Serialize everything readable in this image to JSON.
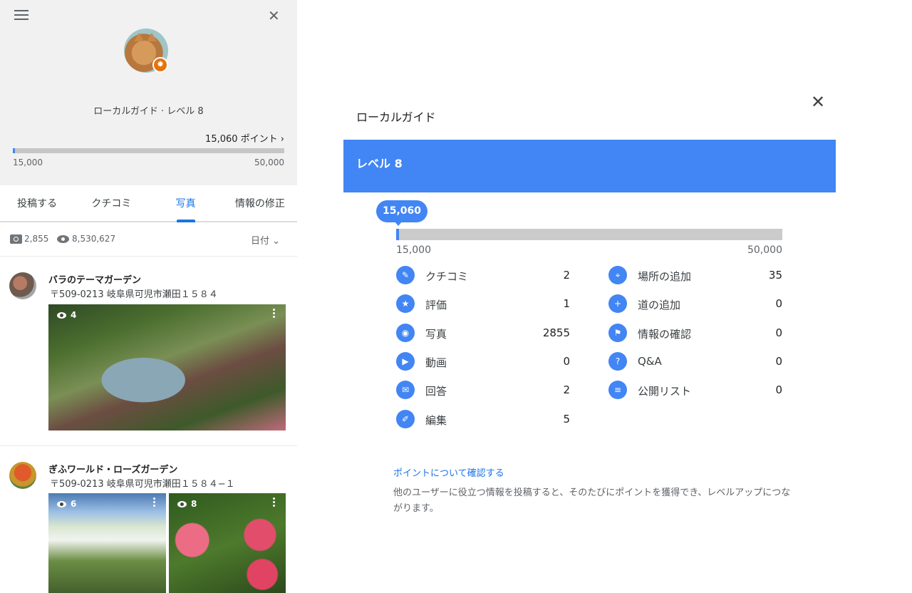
{
  "profile": {
    "guide_level": "ローカルガイド · レベル 8",
    "points_link": "15,060 ポイント ›",
    "bar_min": "15,000",
    "bar_max": "50,000",
    "progress_fraction": 0.0017
  },
  "tabs": [
    {
      "label": "投稿する"
    },
    {
      "label": "クチコミ"
    },
    {
      "label": "写真",
      "active": true
    },
    {
      "label": "情報の修正"
    }
  ],
  "stats": {
    "photo_count": "2,855",
    "view_count": "8,530,627",
    "sort_label": "日付 ⌄"
  },
  "places": [
    {
      "name": "バラのテーマガーデン",
      "address": "〒509-0213 岐阜県可児市瀬田１５８４",
      "photos": [
        {
          "views": "4"
        }
      ]
    },
    {
      "name": "ぎふワールド・ローズガーデン",
      "address": "〒509-0213 岐阜県可児市瀬田１５８４−１",
      "photos": [
        {
          "views": "6"
        },
        {
          "views": "8"
        }
      ]
    }
  ],
  "panel": {
    "title": "ローカルガイド",
    "level": "レベル 8",
    "points_bubble": "15,060",
    "bar_min": "15,000",
    "bar_max": "50,000",
    "progress_fraction": 0.0017,
    "metrics_left": [
      {
        "label": "クチコミ",
        "value": "2",
        "icon": "review-icon"
      },
      {
        "label": "評価",
        "value": "1",
        "icon": "star-icon"
      },
      {
        "label": "写真",
        "value": "2855",
        "icon": "camera-icon"
      },
      {
        "label": "動画",
        "value": "0",
        "icon": "video-icon"
      },
      {
        "label": "回答",
        "value": "2",
        "icon": "answer-icon"
      },
      {
        "label": "編集",
        "value": "5",
        "icon": "edit-icon"
      }
    ],
    "metrics_right": [
      {
        "label": "場所の追加",
        "value": "35",
        "icon": "add-place-icon"
      },
      {
        "label": "道の追加",
        "value": "0",
        "icon": "add-road-icon"
      },
      {
        "label": "情報の確認",
        "value": "0",
        "icon": "flag-icon"
      },
      {
        "label": "Q&A",
        "value": "0",
        "icon": "qa-icon"
      },
      {
        "label": "公開リスト",
        "value": "0",
        "icon": "list-icon"
      }
    ],
    "learn_link": "ポイントについて確認する",
    "description": "他のユーザーに役立つ情報を投稿すると、そのたびにポイントを獲得でき、レベルアップにつながります。"
  },
  "colors": {
    "accent": "#4285f4",
    "link": "#1a73e8",
    "badge": "#e8710a"
  }
}
